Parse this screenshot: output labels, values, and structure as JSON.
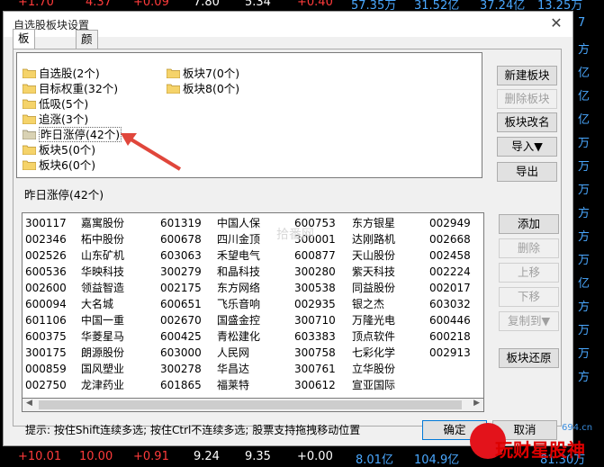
{
  "background": {
    "top_values": [
      "+1.70",
      "4.37",
      "+0.09",
      "7.80",
      "5.34",
      "+0.40",
      "57.35万",
      "31.52亿",
      "37.24亿",
      "13.25万"
    ],
    "right_values": [
      "7",
      "方",
      "亿",
      "亿",
      "亿",
      "万",
      "万",
      "万",
      "方",
      "方",
      "万",
      "亿",
      "方",
      "万",
      "万",
      "方"
    ],
    "bottom_values": [
      "+10.01",
      "10.00",
      "+0.91",
      "9.24",
      "9.35",
      "+0.00",
      "8.01亿",
      "104.9亿",
      "81.30万"
    ]
  },
  "dialog": {
    "title": "自选股板块设置",
    "close_glyph": "✕",
    "tabs": [
      {
        "label": "板块设置",
        "active": true
      },
      {
        "label": "颜色设置",
        "active": false
      }
    ],
    "blocks": [
      {
        "label": "自选股(2个)"
      },
      {
        "label": "目标权重(32个)"
      },
      {
        "label": "低吸(5个)"
      },
      {
        "label": "追涨(3个)"
      },
      {
        "label": "昨日涨停(42个)",
        "selected": true
      },
      {
        "label": "板块5(0个)"
      },
      {
        "label": "板块6(0个)"
      },
      {
        "label": "板块7(0个)"
      },
      {
        "label": "板块8(0个)"
      }
    ],
    "right_buttons": {
      "new_block": "新建板块",
      "delete_block": "删除板块",
      "rename_block": "板块改名",
      "import": "导入▼",
      "export": "导出"
    },
    "section_label": "昨日涨停(42个)",
    "stocks_buttons": {
      "add": "添加",
      "delete": "删除",
      "move_up": "上移",
      "move_down": "下移",
      "copy_to": "复制到▼",
      "restore": "板块还原"
    },
    "stocks": [
      [
        [
          "300117",
          "嘉寓股份"
        ],
        [
          "601319",
          "中国人保"
        ],
        [
          "600753",
          "东方银星"
        ],
        [
          "002949",
          ""
        ]
      ],
      [
        [
          "002346",
          "柘中股份"
        ],
        [
          "600678",
          "四川金顶"
        ],
        [
          "300001",
          "达刚路机"
        ],
        [
          "002668",
          ""
        ]
      ],
      [
        [
          "002526",
          "山东矿机"
        ],
        [
          "603063",
          "禾望电气"
        ],
        [
          "600877",
          "天山股份"
        ],
        [
          "002458",
          ""
        ]
      ],
      [
        [
          "600536",
          "华映科技"
        ],
        [
          "300279",
          "和晶科技"
        ],
        [
          "300280",
          "紫天科技"
        ],
        [
          "002224",
          ""
        ]
      ],
      [
        [
          "002600",
          "领益智造"
        ],
        [
          "002175",
          "东方网络"
        ],
        [
          "300538",
          "同益股份"
        ],
        [
          "002017",
          ""
        ]
      ],
      [
        [
          "600094",
          "大名城"
        ],
        [
          "600651",
          "飞乐音响"
        ],
        [
          "002935",
          "银之杰"
        ],
        [
          "603032",
          ""
        ]
      ],
      [
        [
          "601106",
          "中国一重"
        ],
        [
          "002670",
          "国盛金控"
        ],
        [
          "300710",
          "万隆光电"
        ],
        [
          "600446",
          ""
        ]
      ],
      [
        [
          "600375",
          "华菱星马"
        ],
        [
          "600425",
          "青松建化"
        ],
        [
          "603383",
          "顶点软件"
        ],
        [
          "600218",
          ""
        ]
      ],
      [
        [
          "300175",
          "朗源股份"
        ],
        [
          "603000",
          "人民网"
        ],
        [
          "300758",
          "七彩化学"
        ],
        [
          "002913",
          ""
        ]
      ],
      [
        [
          "000859",
          "国风塑业"
        ],
        [
          "300278",
          "华昌达"
        ],
        [
          "300761",
          "立华股份"
        ],
        [
          "",
          ""
        ]
      ],
      [
        [
          "002750",
          "龙津药业"
        ],
        [
          "601865",
          "福莱特"
        ],
        [
          "300612",
          "宣亚国际"
        ],
        [
          "",
          ""
        ]
      ]
    ],
    "hint": "提示: 按住Shift连续多选; 按住Ctrl不连续多选; 股票支持拖拽移动位置",
    "ok": "确定",
    "cancel": "取消"
  },
  "watermark": {
    "faint": "拾番网",
    "brand": "玩财星股神",
    "url": "694.cn",
    "brand_color": "#e3131b"
  }
}
